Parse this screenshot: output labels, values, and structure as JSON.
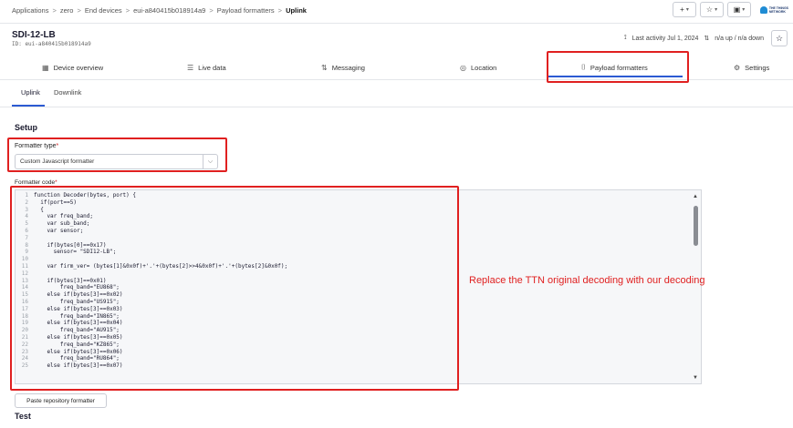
{
  "breadcrumb": {
    "items": [
      "Applications",
      "zero",
      "End devices",
      "eui-a840415b018914a9",
      "Payload formatters"
    ],
    "current": "Uplink",
    "separator": ">"
  },
  "top_actions": {
    "add_label": "+",
    "bookmark_icon": "star-icon",
    "notifications_icon": "inbox-icon",
    "brand_text": "THE THINGS NETWORK"
  },
  "device": {
    "name": "SDI-12-LB",
    "id": "ID: eui-a840415b018914a9",
    "last_activity": "Last activity Jul 1, 2024",
    "traffic": "n/a up / n/a down"
  },
  "tabs": [
    {
      "label": "Device overview",
      "icon": "grid-icon"
    },
    {
      "label": "Live data",
      "icon": "list-icon"
    },
    {
      "label": "Messaging",
      "icon": "arrows-icon"
    },
    {
      "label": "Location",
      "icon": "pin-icon"
    },
    {
      "label": "Payload formatters",
      "icon": "code-icon",
      "active": true
    },
    {
      "label": "Settings",
      "icon": "gear-icon"
    }
  ],
  "subtabs": [
    {
      "label": "Uplink",
      "active": true
    },
    {
      "label": "Downlink"
    }
  ],
  "setup": {
    "title": "Setup",
    "formatter_type_label": "Formatter type",
    "formatter_type_value": "Custom Javascript formatter",
    "required_marker": "*",
    "formatter_code_label": "Formatter code"
  },
  "code": [
    "function Decoder(bytes, port) {",
    "  if(port==5)",
    "  {",
    "    var freq_band;",
    "    var sub_band;",
    "    var sensor;",
    "",
    "    if(bytes[0]==0x17)",
    "      sensor= \"SDI12-LB\";",
    "",
    "    var firm_ver= (bytes[1]&0x0f)+'.'+(bytes[2]>>4&0x0f)+'.'+(bytes[2]&0x0f);",
    "",
    "    if(bytes[3]==0x01)",
    "        freq_band=\"EU868\";",
    "    else if(bytes[3]==0x02)",
    "        freq_band=\"US915\";",
    "    else if(bytes[3]==0x03)",
    "        freq_band=\"IN865\";",
    "    else if(bytes[3]==0x04)",
    "        freq_band=\"AU915\";",
    "    else if(bytes[3]==0x05)",
    "        freq_band=\"KZ865\";",
    "    else if(bytes[3]==0x06)",
    "        freq_band=\"RU864\";",
    "    else if(bytes[3]==0x07)"
  ],
  "annotation": "Replace the TTN original decoding with our decoding",
  "paste_button": "Paste repository formatter",
  "test_title": "Test",
  "colors": {
    "highlight": "#e02020",
    "accent": "#2c5ad2"
  }
}
